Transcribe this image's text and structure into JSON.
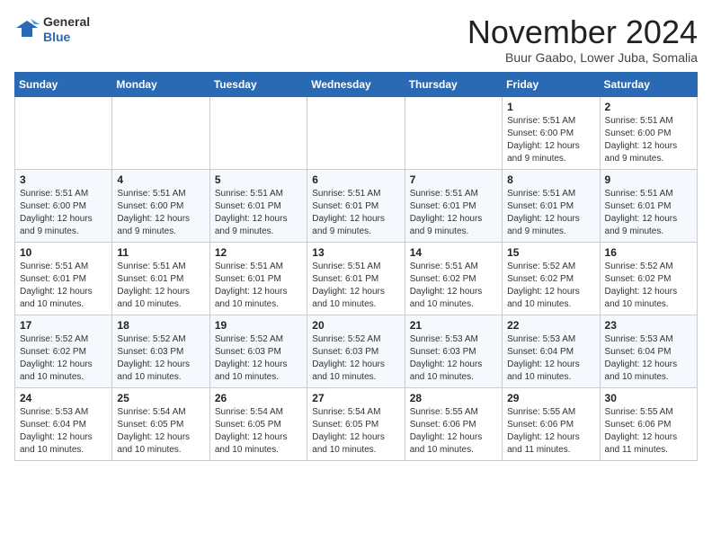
{
  "header": {
    "logo_line1": "General",
    "logo_line2": "Blue",
    "month_title": "November 2024",
    "location": "Buur Gaabo, Lower Juba, Somalia"
  },
  "weekdays": [
    "Sunday",
    "Monday",
    "Tuesday",
    "Wednesday",
    "Thursday",
    "Friday",
    "Saturday"
  ],
  "weeks": [
    [
      {
        "day": "",
        "info": ""
      },
      {
        "day": "",
        "info": ""
      },
      {
        "day": "",
        "info": ""
      },
      {
        "day": "",
        "info": ""
      },
      {
        "day": "",
        "info": ""
      },
      {
        "day": "1",
        "info": "Sunrise: 5:51 AM\nSunset: 6:00 PM\nDaylight: 12 hours\nand 9 minutes."
      },
      {
        "day": "2",
        "info": "Sunrise: 5:51 AM\nSunset: 6:00 PM\nDaylight: 12 hours\nand 9 minutes."
      }
    ],
    [
      {
        "day": "3",
        "info": "Sunrise: 5:51 AM\nSunset: 6:00 PM\nDaylight: 12 hours\nand 9 minutes."
      },
      {
        "day": "4",
        "info": "Sunrise: 5:51 AM\nSunset: 6:00 PM\nDaylight: 12 hours\nand 9 minutes."
      },
      {
        "day": "5",
        "info": "Sunrise: 5:51 AM\nSunset: 6:01 PM\nDaylight: 12 hours\nand 9 minutes."
      },
      {
        "day": "6",
        "info": "Sunrise: 5:51 AM\nSunset: 6:01 PM\nDaylight: 12 hours\nand 9 minutes."
      },
      {
        "day": "7",
        "info": "Sunrise: 5:51 AM\nSunset: 6:01 PM\nDaylight: 12 hours\nand 9 minutes."
      },
      {
        "day": "8",
        "info": "Sunrise: 5:51 AM\nSunset: 6:01 PM\nDaylight: 12 hours\nand 9 minutes."
      },
      {
        "day": "9",
        "info": "Sunrise: 5:51 AM\nSunset: 6:01 PM\nDaylight: 12 hours\nand 9 minutes."
      }
    ],
    [
      {
        "day": "10",
        "info": "Sunrise: 5:51 AM\nSunset: 6:01 PM\nDaylight: 12 hours\nand 10 minutes."
      },
      {
        "day": "11",
        "info": "Sunrise: 5:51 AM\nSunset: 6:01 PM\nDaylight: 12 hours\nand 10 minutes."
      },
      {
        "day": "12",
        "info": "Sunrise: 5:51 AM\nSunset: 6:01 PM\nDaylight: 12 hours\nand 10 minutes."
      },
      {
        "day": "13",
        "info": "Sunrise: 5:51 AM\nSunset: 6:01 PM\nDaylight: 12 hours\nand 10 minutes."
      },
      {
        "day": "14",
        "info": "Sunrise: 5:51 AM\nSunset: 6:02 PM\nDaylight: 12 hours\nand 10 minutes."
      },
      {
        "day": "15",
        "info": "Sunrise: 5:52 AM\nSunset: 6:02 PM\nDaylight: 12 hours\nand 10 minutes."
      },
      {
        "day": "16",
        "info": "Sunrise: 5:52 AM\nSunset: 6:02 PM\nDaylight: 12 hours\nand 10 minutes."
      }
    ],
    [
      {
        "day": "17",
        "info": "Sunrise: 5:52 AM\nSunset: 6:02 PM\nDaylight: 12 hours\nand 10 minutes."
      },
      {
        "day": "18",
        "info": "Sunrise: 5:52 AM\nSunset: 6:03 PM\nDaylight: 12 hours\nand 10 minutes."
      },
      {
        "day": "19",
        "info": "Sunrise: 5:52 AM\nSunset: 6:03 PM\nDaylight: 12 hours\nand 10 minutes."
      },
      {
        "day": "20",
        "info": "Sunrise: 5:52 AM\nSunset: 6:03 PM\nDaylight: 12 hours\nand 10 minutes."
      },
      {
        "day": "21",
        "info": "Sunrise: 5:53 AM\nSunset: 6:03 PM\nDaylight: 12 hours\nand 10 minutes."
      },
      {
        "day": "22",
        "info": "Sunrise: 5:53 AM\nSunset: 6:04 PM\nDaylight: 12 hours\nand 10 minutes."
      },
      {
        "day": "23",
        "info": "Sunrise: 5:53 AM\nSunset: 6:04 PM\nDaylight: 12 hours\nand 10 minutes."
      }
    ],
    [
      {
        "day": "24",
        "info": "Sunrise: 5:53 AM\nSunset: 6:04 PM\nDaylight: 12 hours\nand 10 minutes."
      },
      {
        "day": "25",
        "info": "Sunrise: 5:54 AM\nSunset: 6:05 PM\nDaylight: 12 hours\nand 10 minutes."
      },
      {
        "day": "26",
        "info": "Sunrise: 5:54 AM\nSunset: 6:05 PM\nDaylight: 12 hours\nand 10 minutes."
      },
      {
        "day": "27",
        "info": "Sunrise: 5:54 AM\nSunset: 6:05 PM\nDaylight: 12 hours\nand 10 minutes."
      },
      {
        "day": "28",
        "info": "Sunrise: 5:55 AM\nSunset: 6:06 PM\nDaylight: 12 hours\nand 10 minutes."
      },
      {
        "day": "29",
        "info": "Sunrise: 5:55 AM\nSunset: 6:06 PM\nDaylight: 12 hours\nand 11 minutes."
      },
      {
        "day": "30",
        "info": "Sunrise: 5:55 AM\nSunset: 6:06 PM\nDaylight: 12 hours\nand 11 minutes."
      }
    ]
  ]
}
